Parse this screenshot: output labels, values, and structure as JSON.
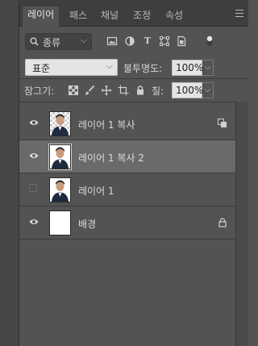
{
  "tabs": [
    {
      "label": "레이어",
      "active": true
    },
    {
      "label": "패스",
      "active": false
    },
    {
      "label": "채널",
      "active": false
    },
    {
      "label": "조정",
      "active": false
    },
    {
      "label": "속성",
      "active": false
    }
  ],
  "filter": {
    "kind_label": "종류",
    "icons": [
      "image-filter-icon",
      "adjustment-filter-icon",
      "type-filter-icon",
      "shape-filter-icon",
      "smart-object-filter-icon"
    ]
  },
  "blend": {
    "mode": "표준",
    "opacity_label": "불투명도:",
    "opacity_value": "100%"
  },
  "lock": {
    "label": "잠그기:",
    "fill_label": "칠:",
    "fill_value": "100%"
  },
  "layers": [
    {
      "name": "레이어 1 복사",
      "visible": true,
      "selected": false,
      "thumb": "checker",
      "badge": "smart-object-icon"
    },
    {
      "name": "레이어 1 복사 2",
      "visible": true,
      "selected": true,
      "thumb": "photo",
      "badge": ""
    },
    {
      "name": "레이어 1",
      "visible": false,
      "selected": false,
      "thumb": "photo",
      "badge": ""
    },
    {
      "name": "배경",
      "visible": true,
      "selected": false,
      "thumb": "white",
      "badge": "lock-icon"
    }
  ],
  "colors": {
    "panel_bg": "#535353",
    "tabbar_bg": "#3e3e3e",
    "selected_row": "#6a6a6a"
  }
}
